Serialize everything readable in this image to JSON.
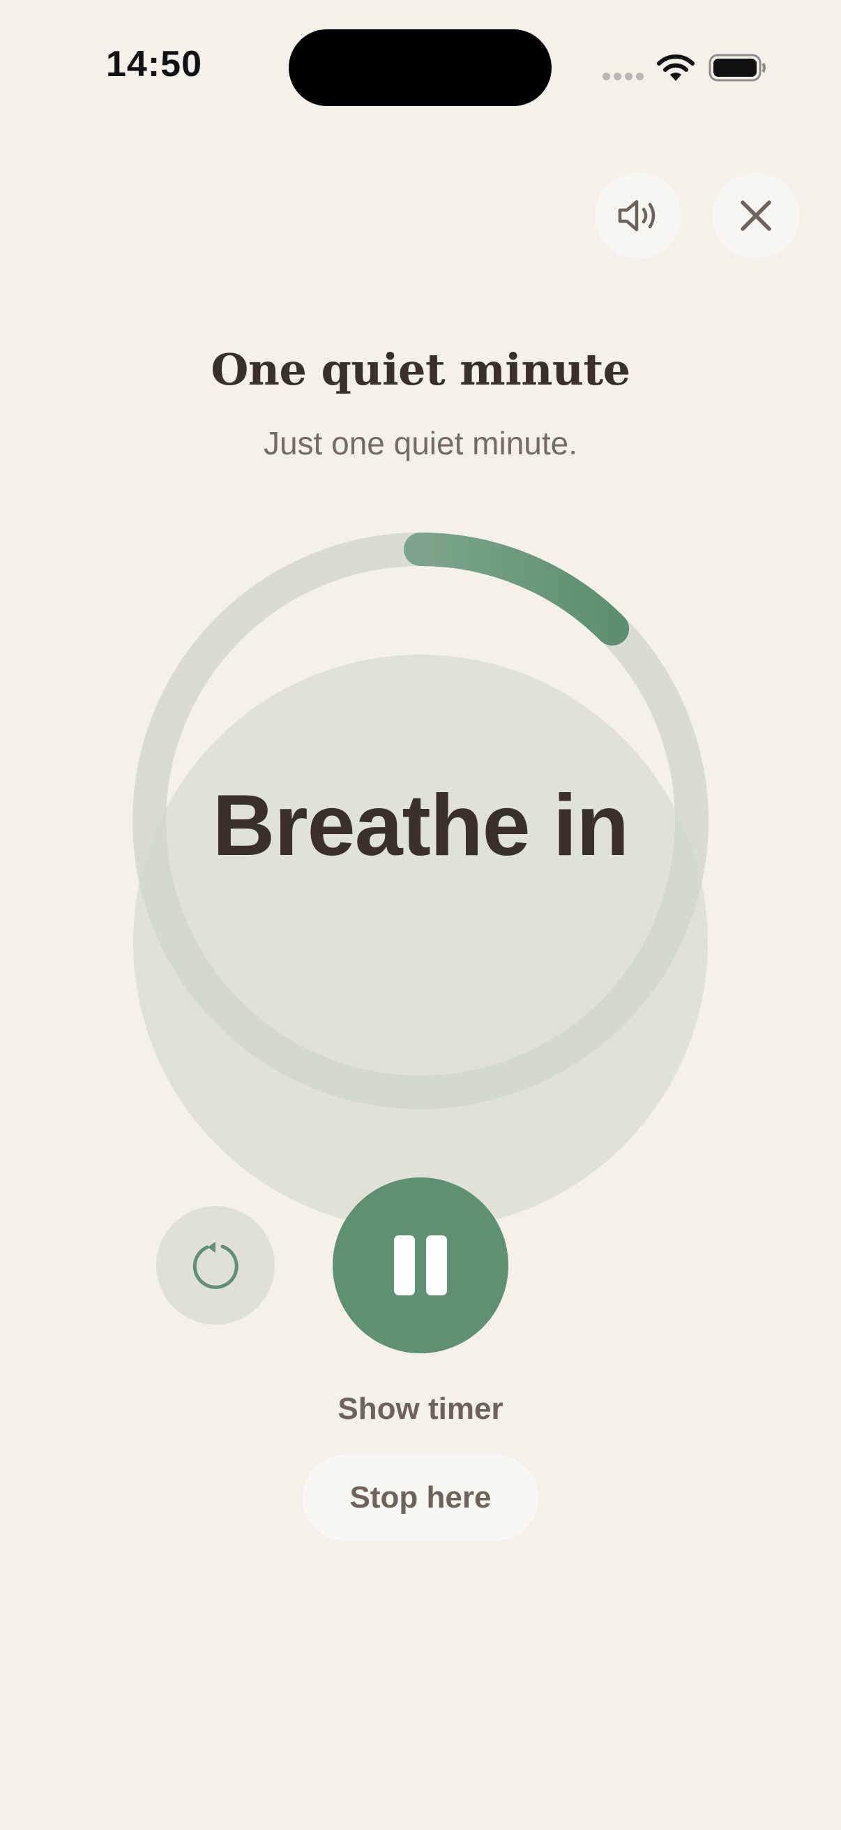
{
  "status_bar": {
    "time": "14:50"
  },
  "top_actions": {
    "sound_icon": "speaker-icon",
    "close_icon": "close-icon"
  },
  "session": {
    "title": "One quiet minute",
    "subtitle": "Just one quiet minute.",
    "phase": "Breathe in",
    "progress": 0.125
  },
  "controls": {
    "restart_icon": "restart-icon",
    "pause_icon": "pause-icon",
    "show_timer_label": "Show timer",
    "stop_label": "Stop here"
  },
  "colors": {
    "background": "#f4f0ea",
    "accent": "#5f9071",
    "ring_track": "#d8ddd3",
    "text_primary": "#3a302b",
    "text_secondary": "#766a64"
  }
}
